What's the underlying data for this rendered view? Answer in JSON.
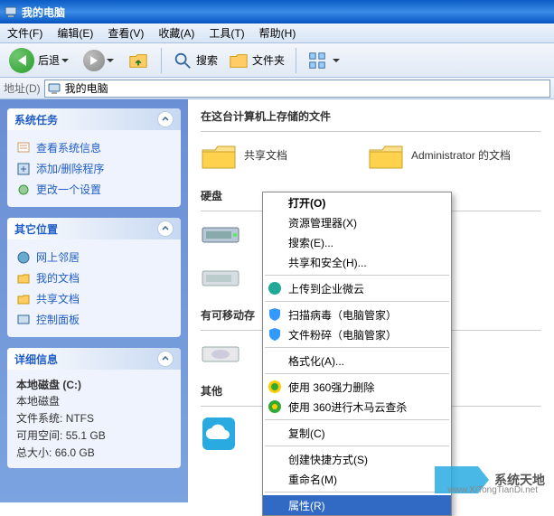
{
  "window": {
    "title": "我的电脑"
  },
  "menu": {
    "file": "文件(F)",
    "edit": "编辑(E)",
    "view": "查看(V)",
    "favorites": "收藏(A)",
    "tools": "工具(T)",
    "help": "帮助(H)"
  },
  "toolbar": {
    "back": "后退",
    "search": "搜索",
    "folders": "文件夹"
  },
  "address": {
    "label": "地址(D)",
    "value": "我的电脑"
  },
  "sidebar": {
    "tasks": {
      "title": "系统任务",
      "items": [
        "查看系统信息",
        "添加/删除程序",
        "更改一个设置"
      ]
    },
    "places": {
      "title": "其它位置",
      "items": [
        "网上邻居",
        "我的文档",
        "共享文档",
        "控制面板"
      ]
    },
    "details": {
      "title": "详细信息",
      "heading": "本地磁盘 (C:)",
      "type": "本地磁盘",
      "fs_label": "文件系统:",
      "fs_value": "NTFS",
      "free_label": "可用空间:",
      "free_value": "55.1 GB",
      "total_label": "总大小:",
      "total_value": "66.0 GB"
    }
  },
  "content": {
    "filesHeader": "在这台计算机上存储的文件",
    "folders": [
      {
        "label": "共享文档"
      },
      {
        "label": "Administrator 的文档"
      }
    ],
    "drivesHeader": "硬盘",
    "removableHeader": "有可移动存",
    "otherHeader": "其他"
  },
  "contextMenu": {
    "open": "打开(O)",
    "explorer": "资源管理器(X)",
    "search": "搜索(E)...",
    "shareSecurity": "共享和安全(H)...",
    "uploadWework": "上传到企业微云",
    "scanVirus": "扫描病毒（电脑管家）",
    "shred": "文件粉碎（电脑管家）",
    "format": "格式化(A)...",
    "forceDel360": "使用 360强力删除",
    "cloudScan360": "使用 360进行木马云查杀",
    "copy": "复制(C)",
    "shortcut": "创建快捷方式(S)",
    "rename": "重命名(M)",
    "properties": "属性(R)"
  },
  "watermark": {
    "text": "系统天地",
    "url": "www.XiTongTianDi.net"
  }
}
